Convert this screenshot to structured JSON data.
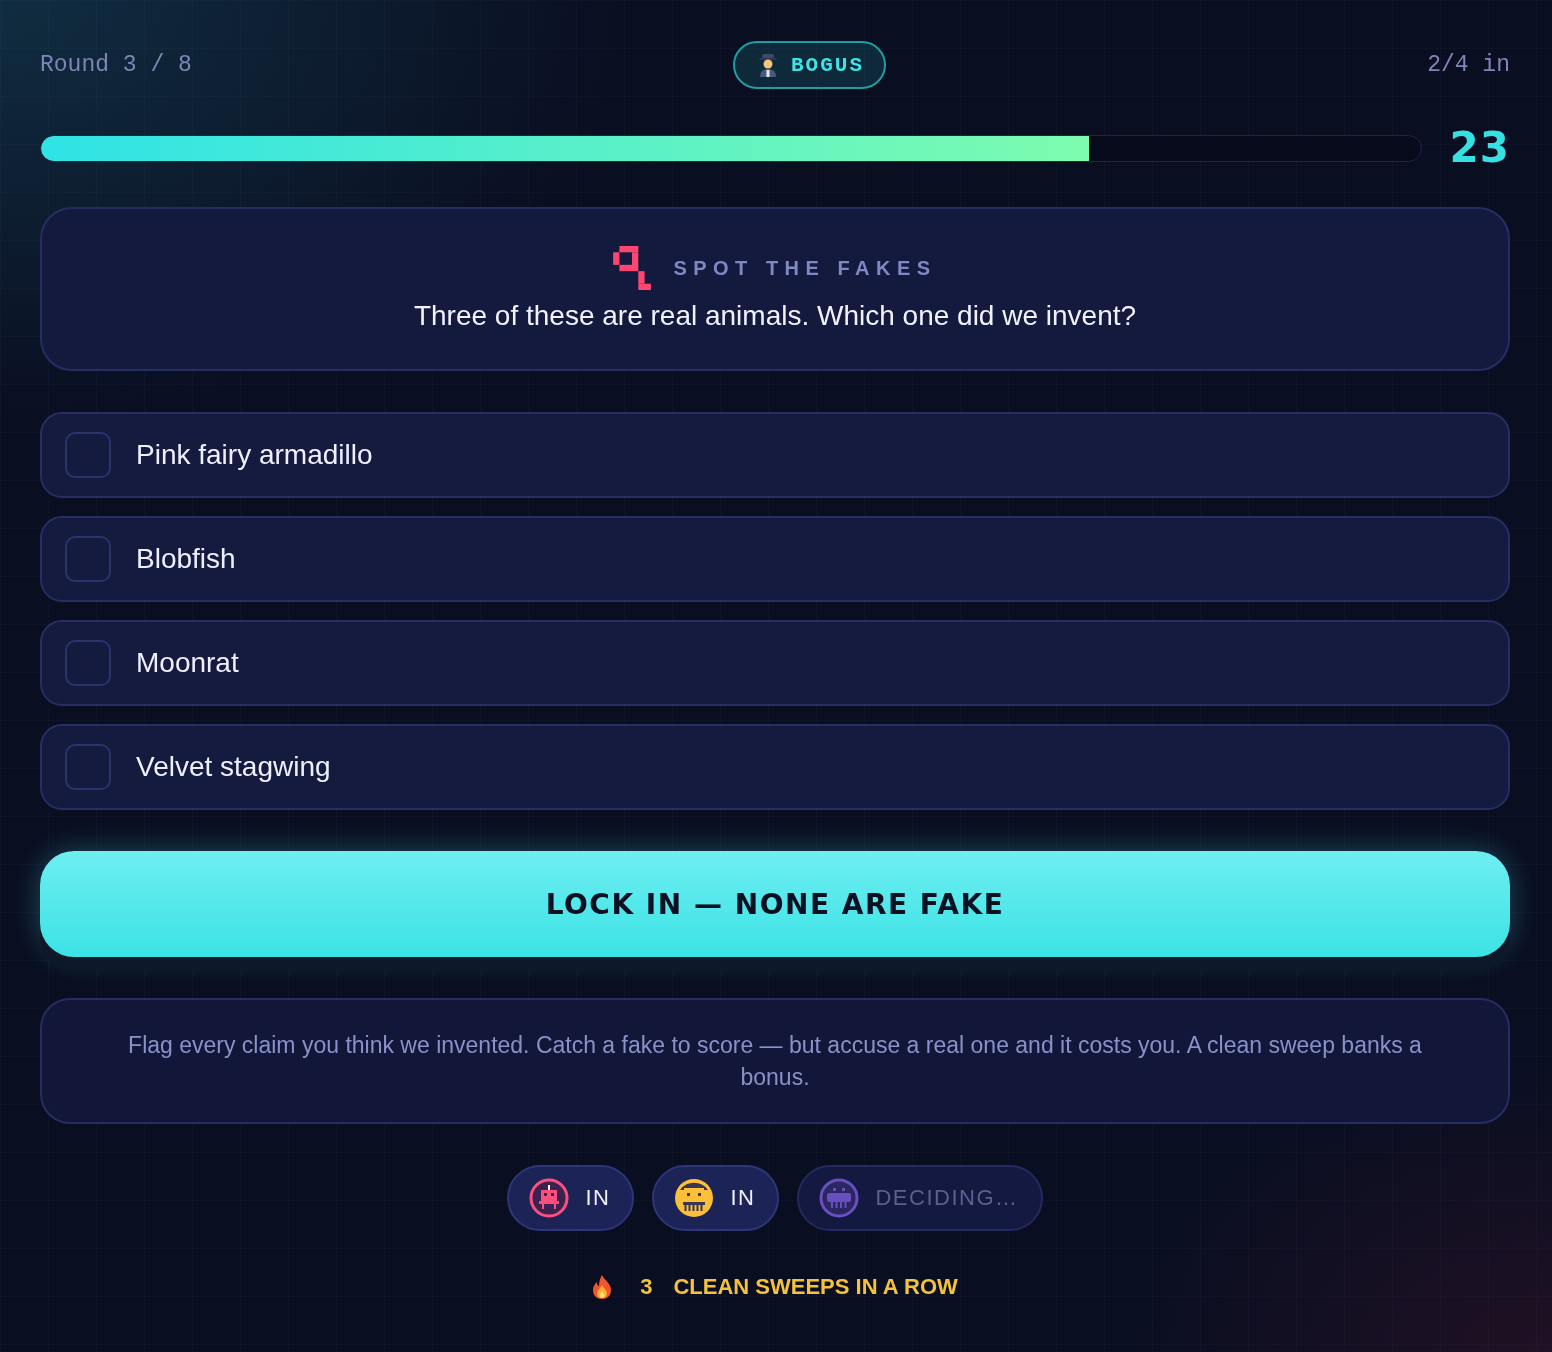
{
  "header": {
    "round": "Round 3 / 8",
    "mode_badge": {
      "label": "BOGUS"
    },
    "players_in": "2/4 in"
  },
  "timer": {
    "level": 0.76,
    "seconds": "23"
  },
  "question": {
    "category": "SPOT THE FAKES",
    "prompt": "Three of these are real animals. Which one did we invent?"
  },
  "options": [
    {
      "label": "Pink fairy armadillo",
      "checked": false
    },
    {
      "label": "Blobfish",
      "checked": false
    },
    {
      "label": "Moonrat",
      "checked": false
    },
    {
      "label": "Velvet stagwing",
      "checked": false
    }
  ],
  "lock_button": {
    "label": "LOCK IN — NONE ARE FAKE"
  },
  "hint": "Flag every claim you think we invented. Catch a fake to score — but accuse a real one and it costs you. A clean sweep banks a bonus.",
  "players": [
    {
      "kind": "robot",
      "color": "#ff4f7e",
      "status": "IN",
      "ready": true
    },
    {
      "kind": "cat",
      "color": "#fbbf3a",
      "status": "IN",
      "ready": true
    },
    {
      "kind": "blob",
      "color": "#6a4fc0",
      "status": "DECIDING…",
      "ready": false
    }
  ],
  "streak": {
    "count": "3",
    "label": "CLEAN SWEEPS IN A ROW"
  }
}
